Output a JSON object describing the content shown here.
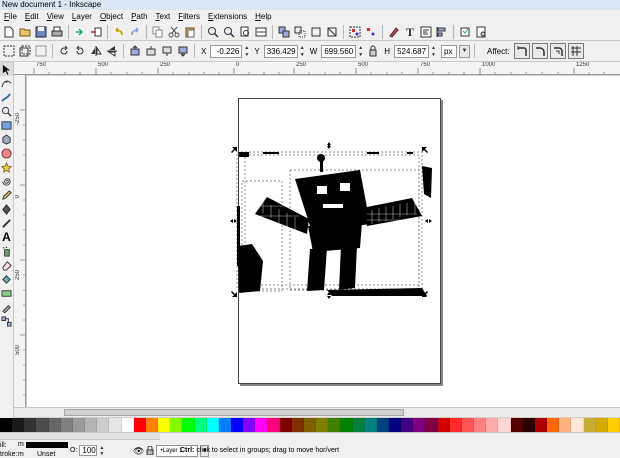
{
  "window": {
    "title": "New document 1 - Inkscape"
  },
  "menu": [
    {
      "label": "File"
    },
    {
      "label": "Edit"
    },
    {
      "label": "View"
    },
    {
      "label": "Layer"
    },
    {
      "label": "Object"
    },
    {
      "label": "Path"
    },
    {
      "label": "Text"
    },
    {
      "label": "Filters"
    },
    {
      "label": "Extensions"
    },
    {
      "label": "Help"
    }
  ],
  "controls": {
    "x_label": "X",
    "x_value": "-0.226",
    "y_label": "Y",
    "y_value": "336.429",
    "w_label": "W",
    "w_value": "699.560",
    "h_label": "H",
    "h_value": "524.687",
    "unit": "px",
    "affect_label": "Affect:"
  },
  "ruler": {
    "h_labels": [
      "750",
      "500",
      "250",
      "0",
      "250",
      "500",
      "750",
      "1000",
      "1250"
    ],
    "v_labels": [
      "-250",
      "0",
      "250",
      "500"
    ]
  },
  "palette": [
    "#000000",
    "#1a1a1a",
    "#333333",
    "#4d4d4d",
    "#666666",
    "#808080",
    "#999999",
    "#b3b3b3",
    "#cccccc",
    "#e6e6e6",
    "#ffffff",
    "#ff0000",
    "#ff8000",
    "#ffff00",
    "#80ff00",
    "#00ff00",
    "#00ff80",
    "#00ffff",
    "#0080ff",
    "#0000ff",
    "#8000ff",
    "#ff00ff",
    "#ff0080",
    "#800000",
    "#803000",
    "#806000",
    "#808000",
    "#408000",
    "#008000",
    "#008040",
    "#008080",
    "#004080",
    "#000080",
    "#400080",
    "#800080",
    "#800040",
    "#d40000",
    "#ff2a2a",
    "#ff5555",
    "#ff8080",
    "#ffaaaa",
    "#ffd5d5",
    "#550000",
    "#2b0000",
    "#aa0000",
    "#ff6600",
    "#ffb380",
    "#ffe6d5",
    "#c8ab37",
    "#d4aa00",
    "#ffcc00"
  ],
  "status": {
    "fill_label": "ill:",
    "stroke_label": "troke:",
    "stroke_value": "m",
    "fill_value": "m",
    "unset_label": "Unset",
    "opacity_label": "O:",
    "opacity_value": "100",
    "layer_name": "•Layer 1",
    "message_bold": "Ctrl:",
    "message": " click to select in groups; drag to move hor/vert"
  }
}
